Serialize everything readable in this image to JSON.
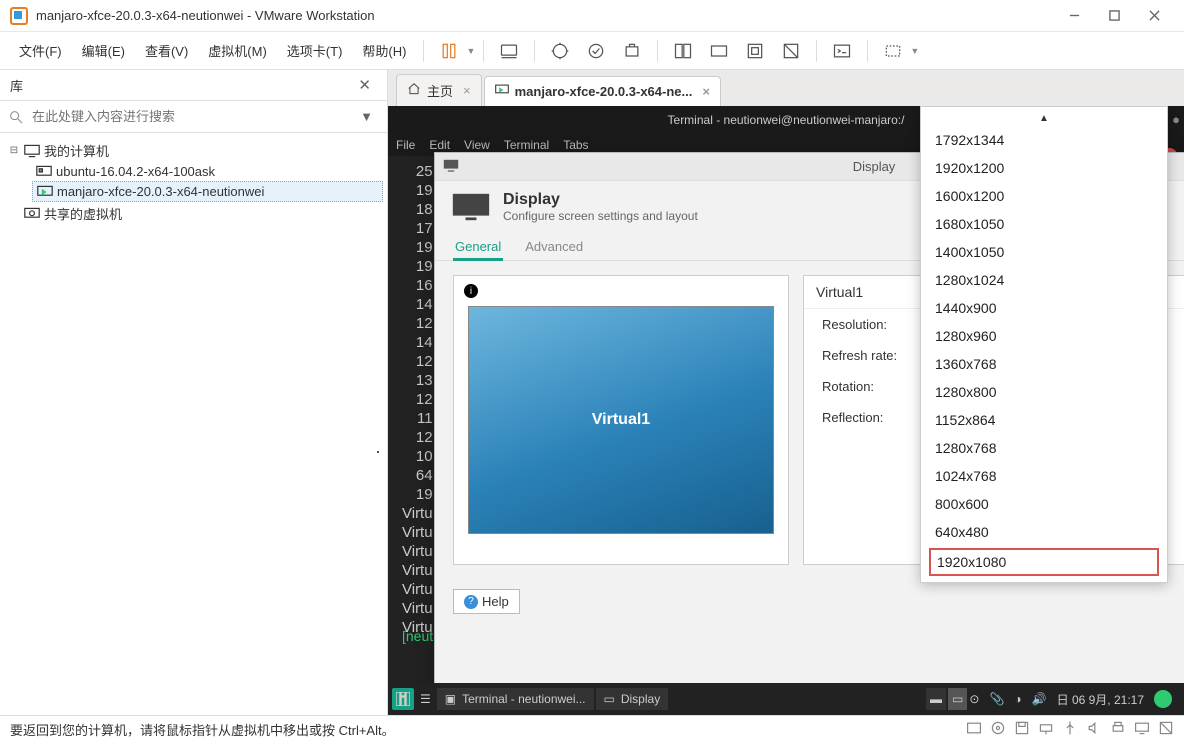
{
  "window": {
    "title": "manjaro-xfce-20.0.3-x64-neutionwei - VMware Workstation"
  },
  "menubar": {
    "items": [
      "文件(F)",
      "编辑(E)",
      "查看(V)",
      "虚拟机(M)",
      "选项卡(T)",
      "帮助(H)"
    ]
  },
  "library": {
    "title": "库",
    "search_placeholder": "在此处键入内容进行搜索",
    "root": "我的计算机",
    "vms": [
      "ubuntu-16.04.2-x64-100ask",
      "manjaro-xfce-20.0.3-x64-neutionwei"
    ],
    "shared": "共享的虚拟机"
  },
  "tabs": {
    "home": "主页",
    "active": "manjaro-xfce-20.0.3-x64-ne..."
  },
  "terminal": {
    "title": "Terminal - neutionwei@neutionwei-manjaro:/",
    "menu": [
      "File",
      "Edit",
      "View",
      "Terminal",
      "Tabs"
    ],
    "lines": [
      "25",
      "19",
      "18",
      "17",
      "19",
      "19",
      "16",
      "14",
      "12",
      "14",
      "12",
      "13",
      "12",
      "11",
      "12",
      "10",
      "64",
      "19",
      "Virtu",
      "Virtu",
      "Virtu",
      "Virtu",
      "Virtu",
      "Virtu",
      "Virtu"
    ],
    "prompt_user": "[neutionwei@neutionwei-manjaro ",
    "prompt_path": "/",
    "prompt_end": "]$ "
  },
  "display": {
    "wintitle": "Display",
    "heading": "Display",
    "subtitle": "Configure screen settings and layout",
    "tab_general": "General",
    "tab_advanced": "Advanced",
    "monitor_name": "Virtual1",
    "props_title": "Virtual1",
    "prop_resolution": "Resolution:",
    "prop_refresh": "Refresh rate:",
    "prop_rotation": "Rotation:",
    "prop_reflection": "Reflection:",
    "help": "Help"
  },
  "resolutions": [
    "1792x1344",
    "1920x1200",
    "1600x1200",
    "1680x1050",
    "1400x1050",
    "1280x1024",
    "1440x900",
    "1280x960",
    "1360x768",
    "1280x800",
    "1152x864",
    "1280x768",
    "1024x768",
    "800x600",
    "640x480",
    "1920x1080"
  ],
  "taskbar": {
    "btn_terminal": "Terminal - neutionwei...",
    "btn_display": "Display",
    "clock": "日 06 9月, 21:17"
  },
  "statusbar": {
    "message": "要返回到您的计算机，请将鼠标指针从虚拟机中移出或按 Ctrl+Alt。"
  }
}
